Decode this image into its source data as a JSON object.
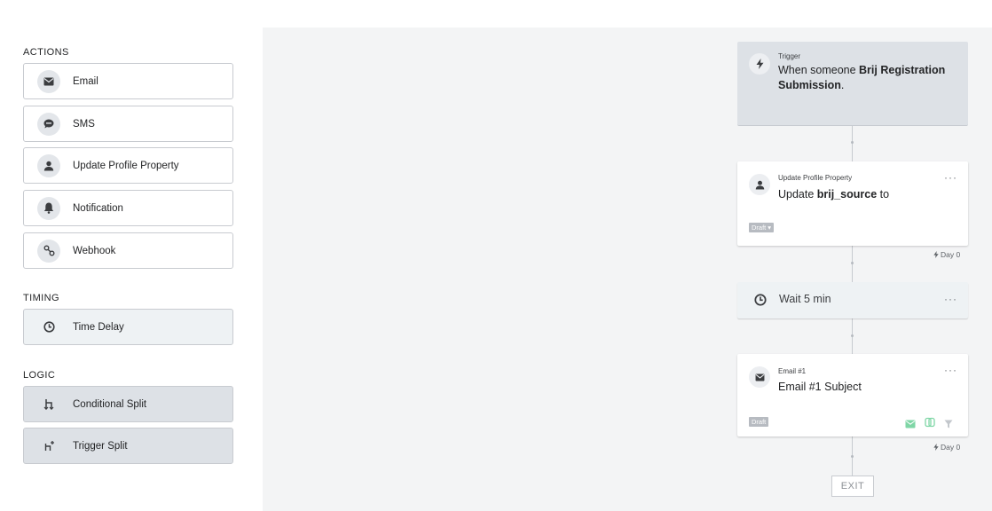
{
  "sidebar": {
    "actions_title": "ACTIONS",
    "timing_title": "TIMING",
    "logic_title": "LOGIC",
    "actions": [
      {
        "label": "Email",
        "icon": "envelope-icon"
      },
      {
        "label": "SMS",
        "icon": "chat-bubble-icon"
      },
      {
        "label": "Update Profile Property",
        "icon": "person-icon"
      },
      {
        "label": "Notification",
        "icon": "bell-icon"
      },
      {
        "label": "Webhook",
        "icon": "webhook-icon"
      }
    ],
    "timing": [
      {
        "label": "Time Delay",
        "icon": "clock-icon"
      }
    ],
    "logic": [
      {
        "label": "Conditional Split",
        "icon": "split-icon"
      },
      {
        "label": "Trigger Split",
        "icon": "trigger-split-icon"
      }
    ]
  },
  "flow": {
    "trigger": {
      "label": "Trigger",
      "text_prefix": "When someone ",
      "text_bold": "Brij Registration Submission",
      "text_suffix": "."
    },
    "update_property": {
      "label": "Update Profile Property",
      "text_prefix": "Update ",
      "text_bold": "brij_source",
      "text_suffix": " to",
      "status": "Draft",
      "more": "···",
      "day": "Day 0"
    },
    "wait": {
      "text": "Wait 5 min",
      "more": "···"
    },
    "email": {
      "label": "Email #1",
      "subject": "Email #1 Subject",
      "status": "Draft",
      "more": "···",
      "day": "Day 0"
    },
    "exit": "EXIT"
  },
  "colors": {
    "canvas_bg": "#f3f4f5",
    "trigger_bg": "#dde1e6",
    "accent_green": "#7fd6a6",
    "draft_badge": "#b7bbc1"
  }
}
